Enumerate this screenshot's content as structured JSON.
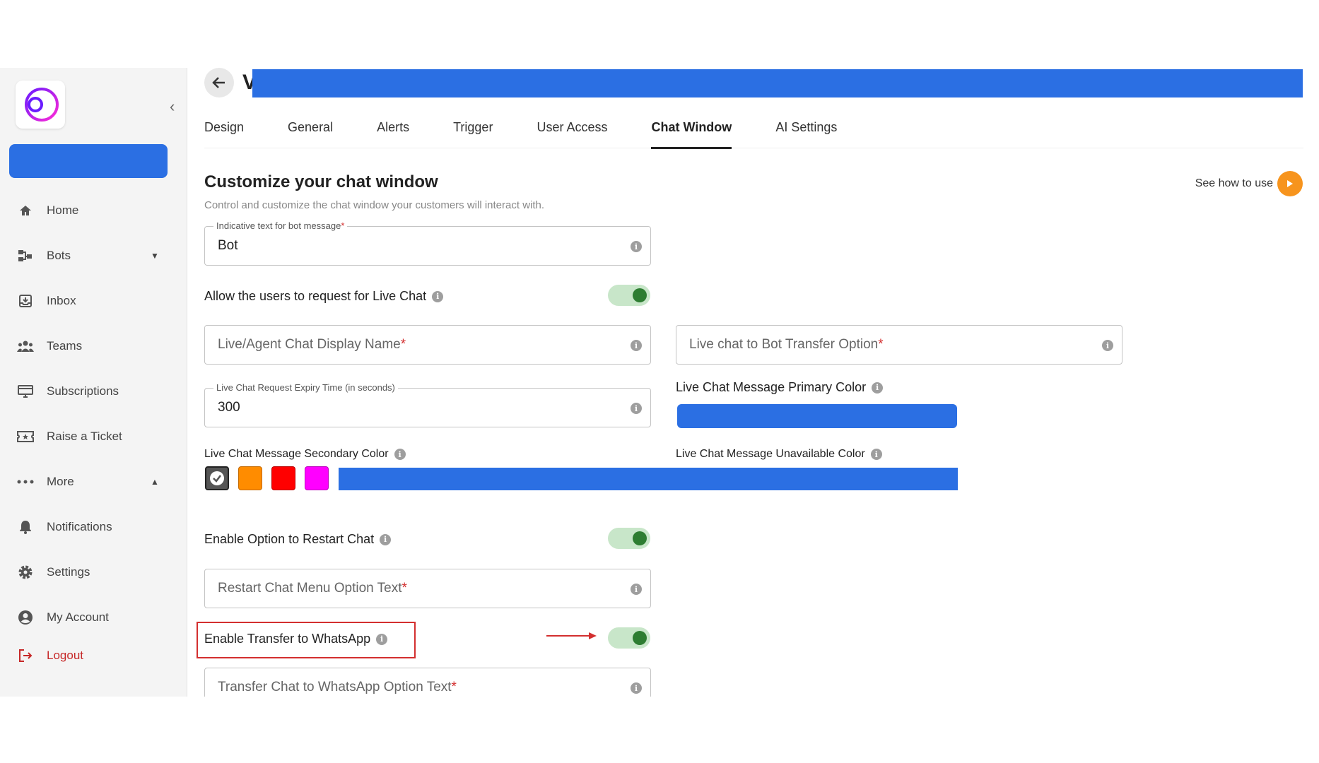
{
  "sidebar": {
    "items": [
      {
        "label": "Home",
        "icon": "home-icon"
      },
      {
        "label": "Bots",
        "icon": "bots-icon",
        "caret": "▼"
      },
      {
        "label": "Inbox",
        "icon": "inbox-icon"
      },
      {
        "label": "Teams",
        "icon": "teams-icon"
      },
      {
        "label": "Subscriptions",
        "icon": "subscriptions-icon"
      },
      {
        "label": "Raise a Ticket",
        "icon": "ticket-icon"
      },
      {
        "label": "More",
        "icon": "more-icon",
        "caret": "▲"
      },
      {
        "label": "Notifications",
        "icon": "bell-icon"
      },
      {
        "label": "Settings",
        "icon": "gear-icon"
      },
      {
        "label": "My Account",
        "icon": "account-icon"
      }
    ],
    "logout": "Logout"
  },
  "header": {
    "title_initial": "V"
  },
  "tabs": [
    "Design",
    "General",
    "Alerts",
    "Trigger",
    "User Access",
    "Chat Window",
    "AI Settings"
  ],
  "active_tab": "Chat Window",
  "section": {
    "title": "Customize your chat window",
    "subtitle": "Control and customize the chat window your customers will interact with.",
    "see_how": "See how to use"
  },
  "form": {
    "bot_text": {
      "label": "Indicative text for bot message",
      "value": "Bot"
    },
    "allow_live_chat": "Allow the users to request for Live Chat",
    "agent_display_name": {
      "placeholder": "Live/Agent Chat Display Name"
    },
    "bot_transfer_option": {
      "placeholder": "Live chat to Bot Transfer Option"
    },
    "expiry_time": {
      "label": "Live Chat Request Expiry Time (in seconds)",
      "value": "300"
    },
    "primary_color_label": "Live Chat Message Primary Color",
    "secondary_color_label": "Live Chat Message Secondary Color",
    "unavailable_color_label": "Live Chat Message Unavailable Color",
    "restart_chat": "Enable Option to Restart Chat",
    "restart_menu_text": {
      "placeholder": "Restart Chat Menu Option Text"
    },
    "transfer_whatsapp": "Enable Transfer to WhatsApp",
    "whatsapp_option_text": {
      "placeholder": "Transfer Chat to WhatsApp Option Text"
    }
  },
  "colors": {
    "accent": "#2e7d32",
    "toggle_track": "#c8e6c9",
    "redaction": "#2b6fe3",
    "secondary_swatches": [
      "#555555",
      "#ff8c00",
      "#ff0000",
      "#ff00ff"
    ],
    "highlight": "#d32f2f",
    "play_button": "#f7941d"
  }
}
